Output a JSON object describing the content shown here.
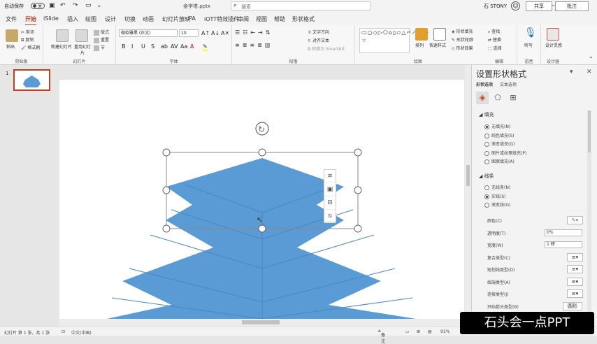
{
  "titlebar": {
    "autosave": "自动保存",
    "autosave_state": "关",
    "filename": "金字塔.pptx",
    "search_placeholder": "搜索",
    "user": "石 STONY",
    "avatar": "ST"
  },
  "tabs": [
    "文件",
    "开始",
    "iSlide",
    "插入",
    "绘图",
    "设计",
    "切换",
    "动画",
    "幻灯片放映",
    "PA",
    "iOTT特效插件",
    "审阅",
    "视图",
    "帮助",
    "形状格式"
  ],
  "active_tab": "开始",
  "share_label": "共享",
  "comment_label": "批注",
  "ribbon": {
    "clipboard": {
      "label": "剪贴板",
      "paste": "粘贴",
      "cut": "剪切",
      "copy": "复制",
      "format_painter": "格式刷"
    },
    "slides": {
      "label": "幻灯片",
      "new_slide": "新建幻灯片",
      "reuse": "重用幻灯片",
      "layout": "版式",
      "reset": "重置",
      "section": "节"
    },
    "font": {
      "label": "字体",
      "font_name": "微软雅黑 (正文)",
      "font_size": "10",
      "buttons": [
        "B",
        "I",
        "U",
        "S",
        "ab",
        "AV",
        "Aa",
        "A"
      ]
    },
    "paragraph": {
      "label": "段落",
      "text_direction": "文字方向",
      "align_text": "对齐文本",
      "smartart": "转换为 SmartArt"
    },
    "drawing": {
      "label": "绘图",
      "arrange": "排列",
      "quick_styles": "快速样式",
      "shape_fill": "形状填充",
      "shape_outline": "形状轮廓",
      "shape_effects": "形状效果"
    },
    "editing": {
      "label": "编辑",
      "find": "查找",
      "replace": "替换",
      "select": "选择"
    },
    "voice": {
      "label": "语音",
      "dictate": "听写"
    },
    "designer": {
      "label": "设计器",
      "design_ideas": "设计灵感"
    },
    "shapes_glyphs": "▭○◇▷⬠⌂▯▱△⌐⟋⟍{}☆"
  },
  "thumb": {
    "number": "1"
  },
  "pane": {
    "title": "设置形状格式",
    "subtabs": [
      "形状选项",
      "文本选项"
    ],
    "fill": {
      "heading": "填充",
      "options": [
        "无填充(N)",
        "纯色填充(S)",
        "渐变填充(G)",
        "图片或纹理填充(P)",
        "图案填充(A)"
      ],
      "selected": 0
    },
    "line": {
      "heading": "线条",
      "options": [
        "无线条(N)",
        "实线(S)",
        "渐变线(G)"
      ],
      "selected": 1
    },
    "props": [
      {
        "label": "颜色(C)",
        "value": ""
      },
      {
        "label": "透明度(T)",
        "value": "0%"
      },
      {
        "label": "宽度(W)",
        "value": "1 磅"
      },
      {
        "label": "复合类型(C)",
        "value": ""
      },
      {
        "label": "短划线类型(D)",
        "value": ""
      },
      {
        "label": "线端类型(A)",
        "value": ""
      },
      {
        "label": "连接类型(J)",
        "value": ""
      },
      {
        "label": "开始箭头类型(B)",
        "value": "圆形"
      }
    ]
  },
  "statusbar": {
    "slide_info": "幻灯片 第 1 张，共 1 张",
    "lang": "中文(中国)",
    "notes": "备注",
    "zoom": "91%"
  },
  "watermark": "石头会一点PPT",
  "colors": {
    "shape_fill": "#5b9bd5",
    "accent": "#b7472a",
    "line_color": "#4472c4"
  }
}
